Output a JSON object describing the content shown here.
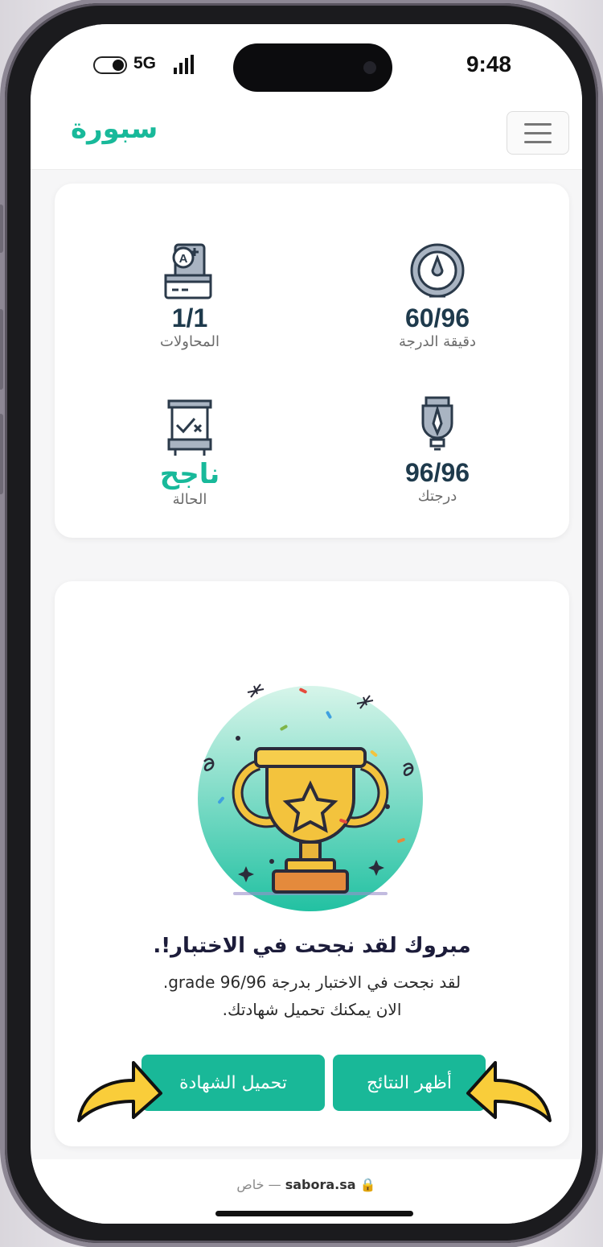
{
  "status_bar": {
    "time": "9:48",
    "network": "5G"
  },
  "header": {
    "logo": "سبورة",
    "menu_icon": "hamburger-icon"
  },
  "stats": [
    {
      "key": "attempts",
      "value": "1/1",
      "label": "المحاولات",
      "icon": "exam-sheet-icon"
    },
    {
      "key": "pass_grade",
      "value": "60/96",
      "label": "دقيقة الدرجة",
      "icon": "gauge-icon"
    },
    {
      "key": "status",
      "value": "ناجح",
      "label": "الحالة",
      "icon": "board-icon"
    },
    {
      "key": "your_grade",
      "value": "96/96",
      "label": "درجتك",
      "icon": "award-pen-icon"
    }
  ],
  "result": {
    "title": "مبروك لقد نجحت في الاختبار!.",
    "line1": "لقد نجحت في الاختبار بدرجة 96/96 grade.",
    "line2": "الان يمكنك تحميل شهادتك.",
    "show_results": "أظهر النتائج",
    "download_certificate": "تحميل الشهادة"
  },
  "browser": {
    "domain": "sabora.sa",
    "label": "خاص",
    "separator": "—"
  },
  "colors": {
    "accent": "#19b898",
    "dark": "#1e3a4c",
    "arrow": "#f9cd3a"
  }
}
